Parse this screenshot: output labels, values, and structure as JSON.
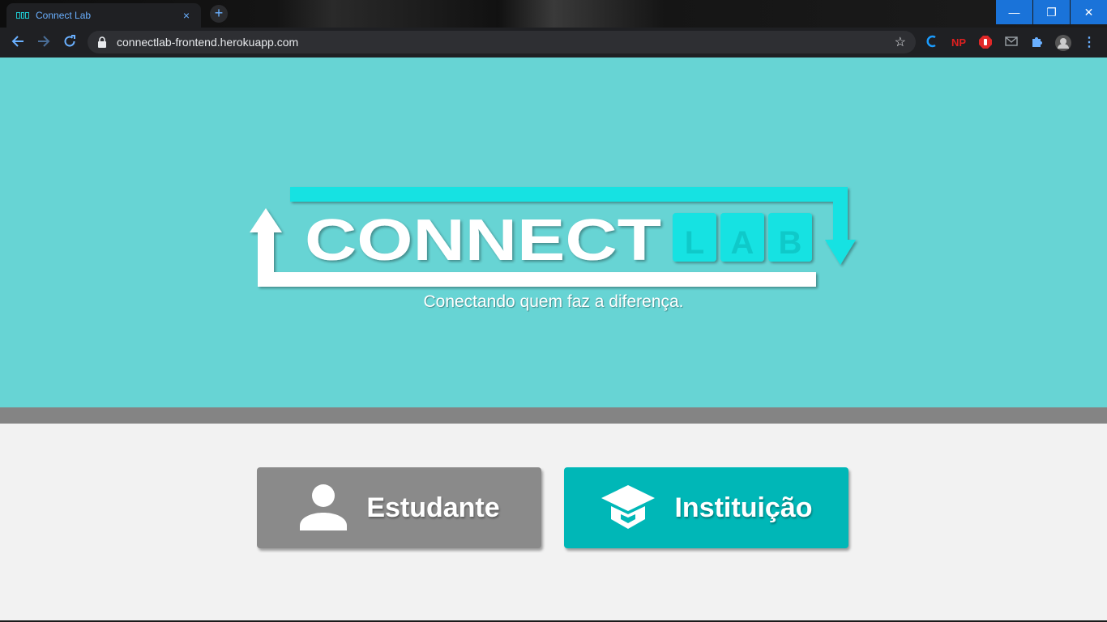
{
  "browser": {
    "tab_title": "Connect Lab",
    "tab_close": "×",
    "new_tab": "+",
    "url": "connectlab-frontend.herokuapp.com",
    "window_buttons": {
      "minimize": "—",
      "restore": "❐",
      "close": "✕"
    },
    "extensions": {
      "np": "NP"
    }
  },
  "hero": {
    "logo_connect": "CONNECT",
    "logo_lab": [
      "L",
      "A",
      "B"
    ],
    "tagline": "Conectando quem faz a diferença."
  },
  "actions": {
    "student_label": "Estudante",
    "institution_label": "Instituição"
  },
  "colors": {
    "hero_bg": "#67d4d4",
    "accent_cyan": "#16e2e2",
    "student_btn": "#8a8a8a",
    "institution_btn": "#00b7b7",
    "band": "#848484"
  }
}
